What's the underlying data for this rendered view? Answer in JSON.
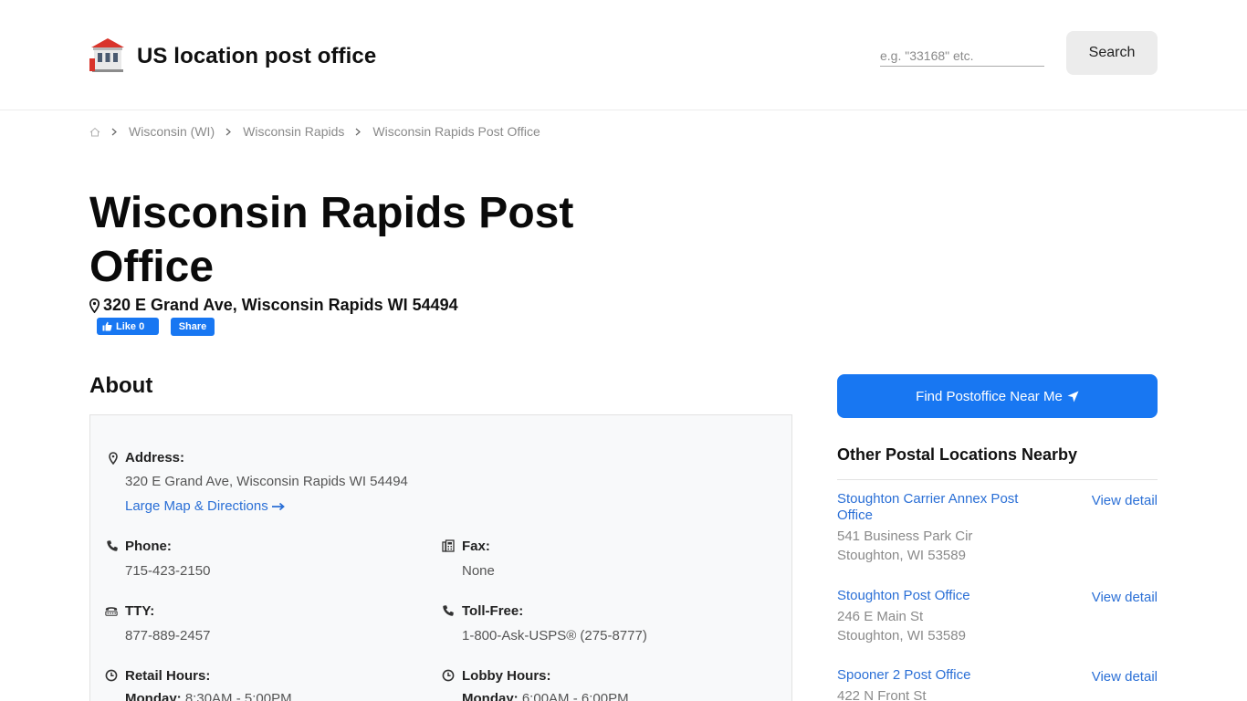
{
  "colors": {
    "accent": "#1877f2",
    "link": "#2a6fd6",
    "muted": "#8a8a8a"
  },
  "header": {
    "site_title": "US location post office",
    "logo_icon": "post-office-building-icon",
    "search_placeholder": "e.g. \"33168\" etc.",
    "search_label": "Search"
  },
  "breadcrumb": {
    "home_icon": "home-icon",
    "items": [
      "Wisconsin (WI)",
      "Wisconsin Rapids",
      "Wisconsin Rapids Post Office"
    ]
  },
  "page": {
    "title": "Wisconsin Rapids Post Office",
    "address": "320 E Grand Ave, Wisconsin Rapids WI 54494",
    "fb_like_label": "Like 0",
    "fb_share_label": "Share"
  },
  "about": {
    "heading": "About",
    "address_label": "Address:",
    "address_value": "320 E Grand Ave, Wisconsin Rapids WI 54494",
    "map_link": "Large Map & Directions",
    "phone_label": "Phone:",
    "phone_value": "715-423-2150",
    "fax_label": "Fax:",
    "fax_value": "None",
    "tty_label": "TTY:",
    "tty_value": "877-889-2457",
    "tollfree_label": "Toll-Free:",
    "tollfree_value": "1-800-Ask-USPS® (275-8777)",
    "retail_label": "Retail Hours:",
    "retail_day": "Monday:",
    "retail_time": "8:30AM - 5:00PM",
    "lobby_label": "Lobby Hours:",
    "lobby_day": "Monday:",
    "lobby_time": "6:00AM - 6:00PM"
  },
  "sidebar": {
    "find_button": "Find Postoffice Near Me",
    "nearby_heading": "Other Postal Locations Nearby",
    "view_detail": "View detail",
    "locations": [
      {
        "name": "Stoughton Carrier Annex Post Office",
        "line1": "541 Business Park Cir",
        "line2": "Stoughton, WI 53589"
      },
      {
        "name": "Stoughton Post Office",
        "line1": "246 E Main St",
        "line2": "Stoughton, WI 53589"
      },
      {
        "name": "Spooner 2 Post Office",
        "line1": "422 N Front St",
        "line2": ""
      }
    ]
  }
}
